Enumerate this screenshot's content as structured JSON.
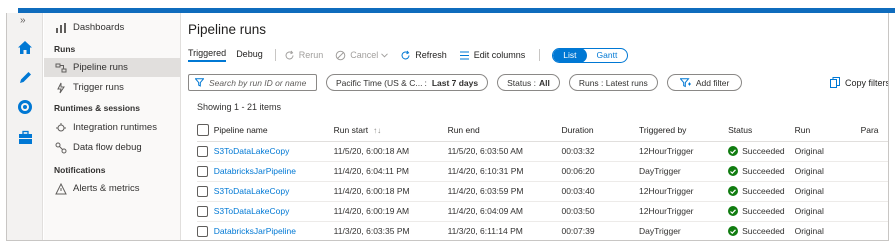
{
  "rail": {
    "collapse_glyph": "»",
    "icons": [
      "home-icon",
      "author-pencil-icon",
      "monitor-icon",
      "manage-toolbox-icon"
    ]
  },
  "nav": {
    "items_top": [
      {
        "label": "Dashboards",
        "icon": "dashboard-icon"
      }
    ],
    "groups": [
      {
        "title": "Runs",
        "items": [
          {
            "label": "Pipeline runs",
            "icon": "pipeline-icon",
            "selected": true
          },
          {
            "label": "Trigger runs",
            "icon": "trigger-icon",
            "selected": false
          }
        ]
      },
      {
        "title": "Runtimes & sessions",
        "items": [
          {
            "label": "Integration runtimes",
            "icon": "integration-runtime-icon",
            "selected": false
          },
          {
            "label": "Data flow debug",
            "icon": "dataflow-debug-icon",
            "selected": false
          }
        ]
      },
      {
        "title": "Notifications",
        "items": [
          {
            "label": "Alerts & metrics",
            "icon": "alert-icon",
            "selected": false
          }
        ]
      }
    ]
  },
  "page": {
    "title": "Pipeline runs"
  },
  "toolbar": {
    "tab_triggered": "Triggered",
    "tab_debug": "Debug",
    "rerun": "Rerun",
    "cancel": "Cancel",
    "refresh": "Refresh",
    "edit_columns": "Edit columns",
    "view_list": "List",
    "view_gantt": "Gantt"
  },
  "filters": {
    "search_placeholder": "Search by run ID or name",
    "timezone": "Pacific Time (US & C...",
    "timerange": "Last 7 days",
    "status_label": "Status :",
    "status_value": "All",
    "runs_label": "Runs : Latest runs",
    "add_filter": "Add filter",
    "copy_filters": "Copy filters"
  },
  "list": {
    "showing": "Showing 1 - 21 items",
    "columns": [
      "Pipeline name",
      "Run start",
      "Run end",
      "Duration",
      "Triggered by",
      "Status",
      "Run",
      "Para"
    ],
    "rows": [
      {
        "name": "S3ToDataLakeCopy",
        "start": "11/5/20, 6:00:18 AM",
        "end": "11/5/20, 6:03:50 AM",
        "duration": "00:03:32",
        "trigger": "12HourTrigger",
        "status": "Succeeded",
        "run": "Original"
      },
      {
        "name": "DatabricksJarPipeline",
        "start": "11/4/20, 6:04:11 PM",
        "end": "11/4/20, 6:10:31 PM",
        "duration": "00:06:20",
        "trigger": "DayTrigger",
        "status": "Succeeded",
        "run": "Original"
      },
      {
        "name": "S3ToDataLakeCopy",
        "start": "11/4/20, 6:00:18 PM",
        "end": "11/4/20, 6:03:59 PM",
        "duration": "00:03:40",
        "trigger": "12HourTrigger",
        "status": "Succeeded",
        "run": "Original"
      },
      {
        "name": "S3ToDataLakeCopy",
        "start": "11/4/20, 6:00:19 AM",
        "end": "11/4/20, 6:04:09 AM",
        "duration": "00:03:50",
        "trigger": "12HourTrigger",
        "status": "Succeeded",
        "run": "Original"
      },
      {
        "name": "DatabricksJarPipeline",
        "start": "11/3/20, 6:03:35 PM",
        "end": "11/3/20, 6:11:14 PM",
        "duration": "00:07:39",
        "trigger": "DayTrigger",
        "status": "Succeeded",
        "run": "Original"
      }
    ]
  },
  "colors": {
    "accent": "#0078d4",
    "success": "#107c10"
  }
}
